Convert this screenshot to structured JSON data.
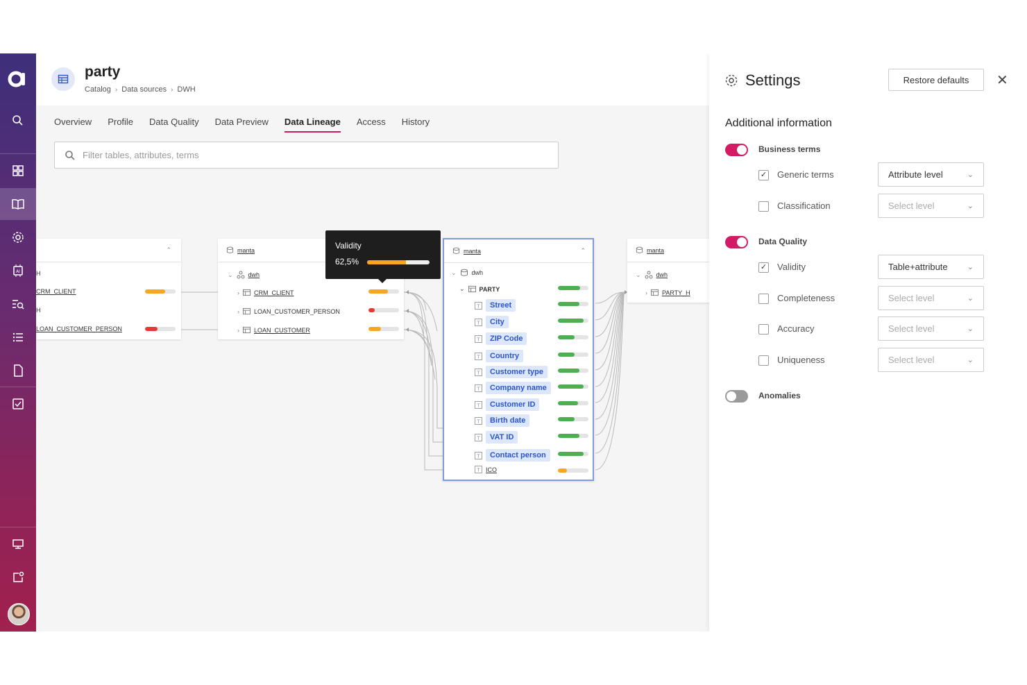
{
  "header": {
    "title": "party",
    "breadcrumbs": [
      "Catalog",
      "Data sources",
      "DWH"
    ]
  },
  "tabs": [
    "Overview",
    "Profile",
    "Data Quality",
    "Data Preview",
    "Data Lineage",
    "Access",
    "History"
  ],
  "active_tab": "Data Lineage",
  "search": {
    "placeholder": "Filter tables, attributes, terms"
  },
  "lineage": {
    "left_card": {
      "rows": [
        {
          "label": "H"
        },
        {
          "label": "CRM_CLIENT",
          "quality": 0.65,
          "color": "#f5a623"
        },
        {
          "label": "H"
        },
        {
          "label": "LOAN_CUSTOMER_PERSON",
          "quality": 0.4,
          "color": "#e53935"
        }
      ]
    },
    "source_card": {
      "db": "manta",
      "schema": "dwh",
      "rows": [
        {
          "label": "CRM_CLIENT",
          "quality": 0.625,
          "color": "#f5a623"
        },
        {
          "label": "LOAN_CUSTOMER_PERSON",
          "quality": 0.2,
          "color": "#e53935"
        },
        {
          "label": "LOAN_CUSTOMER",
          "quality": 0.4,
          "color": "#f5a623"
        }
      ]
    },
    "tooltip": {
      "title": "Validity",
      "value": "62,5%",
      "quality": 0.625
    },
    "main_card": {
      "db": "manta",
      "schema": "dwh",
      "table": "PARTY",
      "table_quality": 0.72,
      "attributes": [
        {
          "label": "Street",
          "quality": 0.7,
          "color": "#4caf50",
          "highlight": true
        },
        {
          "label": "City",
          "quality": 0.85,
          "color": "#4caf50",
          "highlight": true
        },
        {
          "label": "ZIP Code",
          "quality": 0.55,
          "color": "#4caf50",
          "highlight": true
        },
        {
          "label": "Country",
          "quality": 0.55,
          "color": "#4caf50",
          "highlight": true
        },
        {
          "label": "Customer type",
          "quality": 0.7,
          "color": "#4caf50",
          "highlight": true
        },
        {
          "label": "Company name",
          "quality": 0.85,
          "color": "#4caf50",
          "highlight": true
        },
        {
          "label": "Customer ID",
          "quality": 0.65,
          "color": "#4caf50",
          "highlight": true
        },
        {
          "label": "Birth date",
          "quality": 0.55,
          "color": "#4caf50",
          "highlight": true
        },
        {
          "label": "VAT ID",
          "quality": 0.7,
          "color": "#4caf50",
          "highlight": true
        },
        {
          "label": "Contact person",
          "quality": 0.85,
          "color": "#4caf50",
          "highlight": true
        },
        {
          "label": "ICO",
          "quality": 0.3,
          "color": "#f5a623",
          "highlight": false
        }
      ]
    },
    "target_card": {
      "db": "manta",
      "schema": "dwh",
      "rows": [
        {
          "label": "PARTY_H"
        }
      ]
    }
  },
  "settings": {
    "title": "Settings",
    "restore_label": "Restore defaults",
    "section_title": "Additional information",
    "groups": [
      {
        "label": "Business terms",
        "on": true,
        "items": [
          {
            "label": "Generic terms",
            "checked": true,
            "level": "Attribute level",
            "placeholder": false
          },
          {
            "label": "Classification",
            "checked": false,
            "level": "Select level",
            "placeholder": true
          }
        ]
      },
      {
        "label": "Data Quality",
        "on": true,
        "items": [
          {
            "label": "Validity",
            "checked": true,
            "level": "Table+attribute",
            "placeholder": false
          },
          {
            "label": "Completeness",
            "checked": false,
            "level": "Select level",
            "placeholder": true
          },
          {
            "label": "Accuracy",
            "checked": false,
            "level": "Select level",
            "placeholder": true
          },
          {
            "label": "Uniqueness",
            "checked": false,
            "level": "Select level",
            "placeholder": true
          }
        ]
      },
      {
        "label": "Anomalies",
        "on": false,
        "items": []
      }
    ]
  },
  "colors": {
    "accent": "#c81c5f",
    "toggle_on": "#d41a64",
    "good": "#4caf50",
    "warn": "#f5a623",
    "bad": "#e53935",
    "tag_bg": "#dde7fb",
    "tag_text": "#2b55c8"
  }
}
